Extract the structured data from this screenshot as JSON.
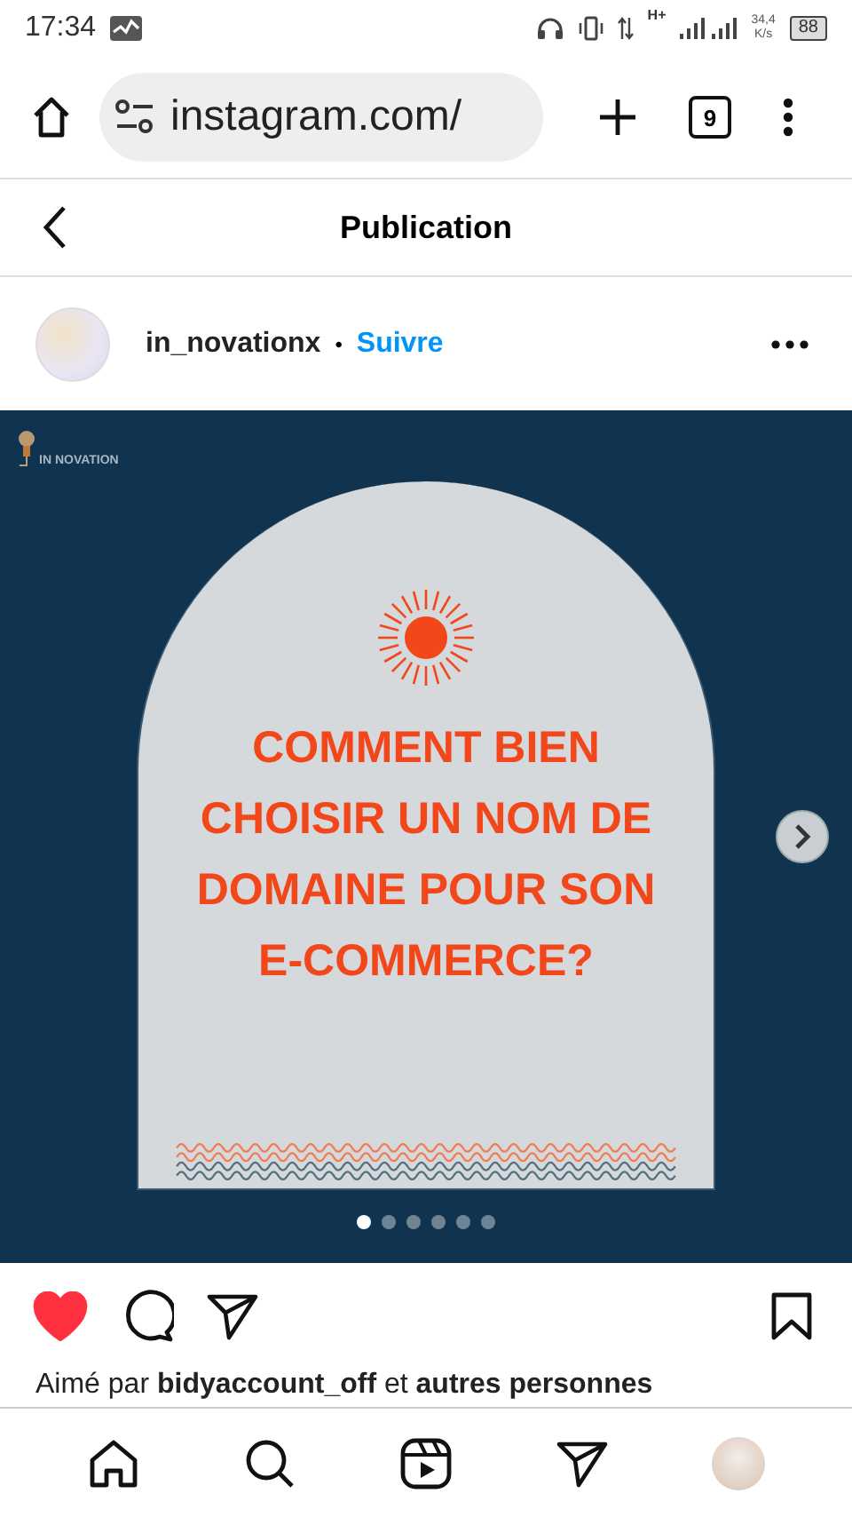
{
  "status_bar": {
    "time": "17:34",
    "network": "H+",
    "speed": "34,4",
    "speed_unit": "K/s",
    "battery": "88"
  },
  "browser": {
    "url": "instagram.com/",
    "tab_count": "9"
  },
  "header": {
    "title": "Publication"
  },
  "post": {
    "username": "in_novationx",
    "separator": "•",
    "follow": "Suivre",
    "slide": {
      "brand": "IN NOVATION",
      "title_lines": [
        "COMMENT BIEN",
        "CHOISIR UN NOM DE",
        "DOMAINE POUR SON",
        "E-COMMERCE?"
      ]
    },
    "dots": [
      {
        "selected": true
      },
      {
        "selected": false
      },
      {
        "selected": false
      },
      {
        "selected": false
      },
      {
        "selected": false
      },
      {
        "selected": false
      }
    ],
    "liked": true,
    "saved": false,
    "likes_text": "Aimé par **bidyaccount_off** et **autres personnes**"
  }
}
